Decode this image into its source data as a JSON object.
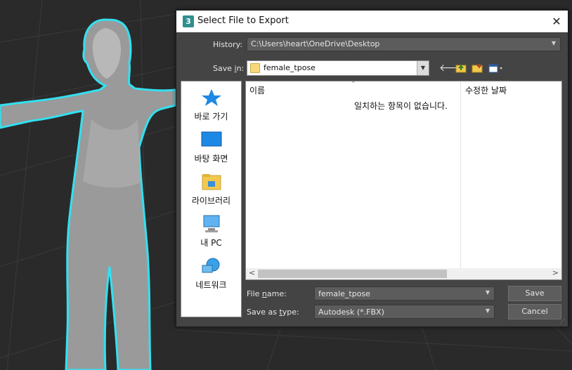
{
  "dialog": {
    "title": "Select File to Export",
    "app_icon_text": "3",
    "close_symbol": "✕"
  },
  "history": {
    "label": "History:",
    "value": "C:\\Users\\heart\\OneDrive\\Desktop"
  },
  "save_in": {
    "label_pre": "Save ",
    "label_u": "i",
    "label_post": "n:",
    "value": "female_tpose"
  },
  "toolbar": {
    "back_icon": "back-arrow-icon",
    "up_icon": "up-folder-icon",
    "new_folder_icon": "new-folder-icon",
    "view_menu_icon": "view-menu-icon"
  },
  "places": [
    {
      "label": "바로 가기",
      "icon": "quick-access-star-icon"
    },
    {
      "label": "바탕 화면",
      "icon": "desktop-icon"
    },
    {
      "label": "라이브러리",
      "icon": "libraries-icon"
    },
    {
      "label": "내 PC",
      "icon": "this-pc-icon"
    },
    {
      "label": "네트워크",
      "icon": "network-icon"
    }
  ],
  "file_list": {
    "columns": [
      "이름",
      "수정한 날짜"
    ],
    "empty_message": "일치하는 항목이 없습니다."
  },
  "file_name": {
    "label_pre": "File ",
    "label_u": "n",
    "label_post": "ame:",
    "value": "female_tpose"
  },
  "save_as_type": {
    "label_pre": "Save as ",
    "label_u": "t",
    "label_post": "ype:",
    "value": "Autodesk (*.FBX)"
  },
  "buttons": {
    "save": "Save",
    "cancel": "Cancel"
  },
  "colors": {
    "viewport_bg": "#2a2a2a",
    "selection_outline": "#33e0f0",
    "dialog_bg": "#444444"
  }
}
